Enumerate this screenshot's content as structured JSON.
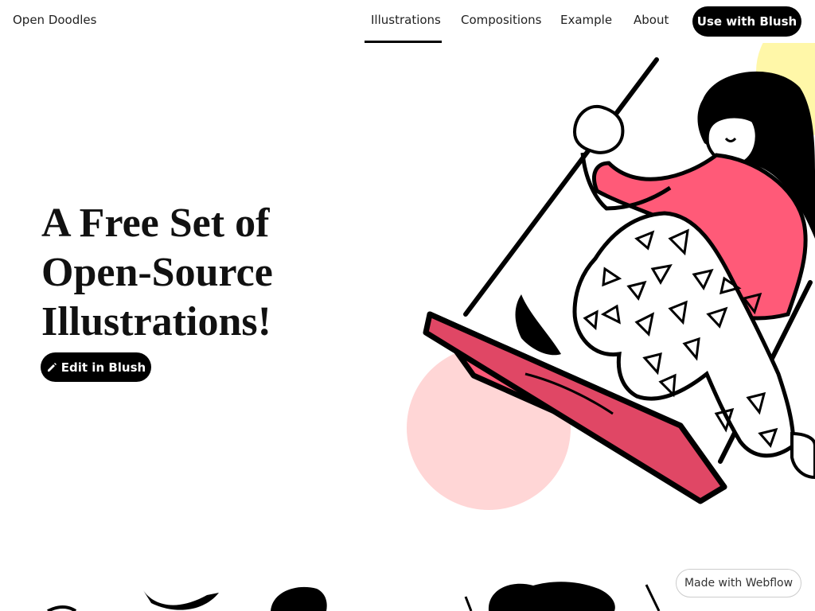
{
  "header": {
    "brand": "Open Doodles",
    "nav": [
      {
        "label": "Illustrations",
        "active": true
      },
      {
        "label": "Compositions",
        "active": false
      },
      {
        "label": "Example",
        "active": false
      },
      {
        "label": "About",
        "active": false
      }
    ],
    "cta_label": "Use with Blush"
  },
  "hero": {
    "title_lines": [
      "A Free Set of",
      "Open-Source",
      "Illustrations!"
    ],
    "edit_button_label": "Edit in Blush",
    "edit_icon": "pencil-icon"
  },
  "badge": {
    "label": "Made with Webflow"
  },
  "colors": {
    "pink": "#FF5A78",
    "light_pink": "#FFD6D6",
    "yellow": "#FFF7A8",
    "black": "#000000"
  }
}
